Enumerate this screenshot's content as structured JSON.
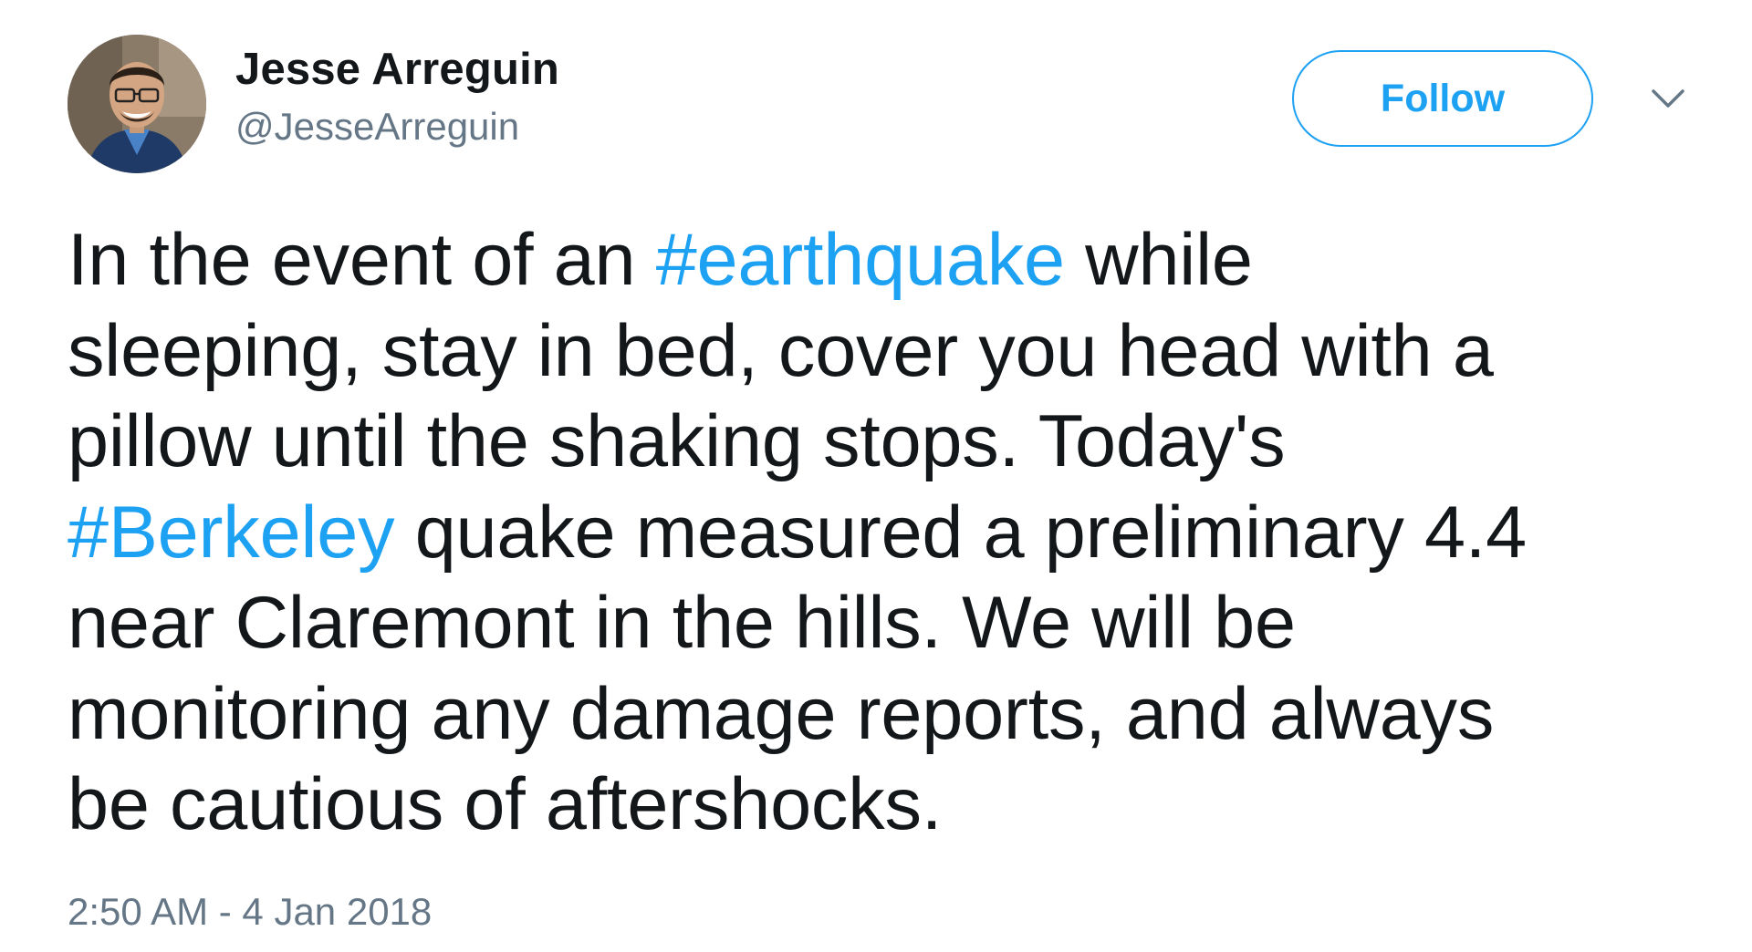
{
  "user": {
    "display_name": "Jesse Arreguin",
    "screen_name": "@JesseArreguin",
    "avatar_icon": "profile-photo"
  },
  "actions": {
    "follow_label": "Follow",
    "more_icon": "chevron-down-icon"
  },
  "tweet": {
    "lines": [
      [
        {
          "t": "In the event of an "
        },
        {
          "t": "#earthquake",
          "tag": true
        },
        {
          "t": " while"
        }
      ],
      [
        {
          "t": "sleeping, stay in bed, cover you head with a"
        }
      ],
      [
        {
          "t": "pillow until the shaking stops. Today's"
        }
      ],
      [
        {
          "t": "#Berkeley",
          "tag": true
        },
        {
          "t": " quake measured a preliminary 4.4"
        }
      ],
      [
        {
          "t": "near Claremont in the hills. We will be"
        }
      ],
      [
        {
          "t": "monitoring any damage reports, and always"
        }
      ],
      [
        {
          "t": "be cautious of aftershocks."
        }
      ]
    ],
    "timestamp": "2:50 AM - 4 Jan 2018"
  },
  "colors": {
    "accent": "#1da1f2",
    "text": "#14171a",
    "secondary": "#657786",
    "background": "#ffffff"
  }
}
